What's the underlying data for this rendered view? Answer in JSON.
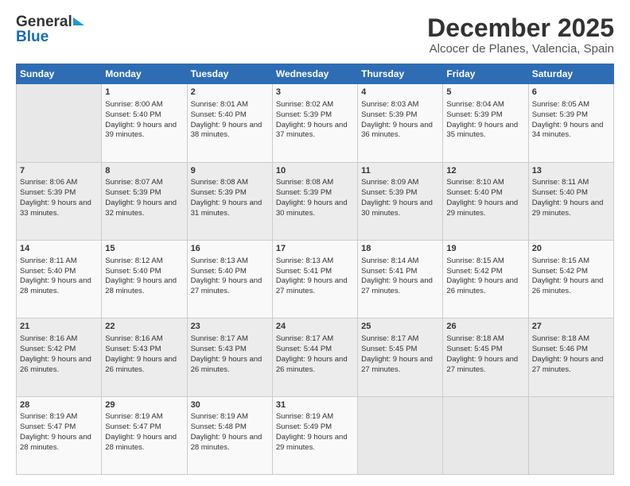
{
  "header": {
    "logo_general": "General",
    "logo_blue": "Blue",
    "title": "December 2025",
    "subtitle": "Alcocer de Planes, Valencia, Spain"
  },
  "weekdays": [
    "Sunday",
    "Monday",
    "Tuesday",
    "Wednesday",
    "Thursday",
    "Friday",
    "Saturday"
  ],
  "weeks": [
    [
      {
        "day": "",
        "sunrise": "",
        "sunset": "",
        "daylight": ""
      },
      {
        "day": "1",
        "sunrise": "Sunrise: 8:00 AM",
        "sunset": "Sunset: 5:40 PM",
        "daylight": "Daylight: 9 hours and 39 minutes."
      },
      {
        "day": "2",
        "sunrise": "Sunrise: 8:01 AM",
        "sunset": "Sunset: 5:40 PM",
        "daylight": "Daylight: 9 hours and 38 minutes."
      },
      {
        "day": "3",
        "sunrise": "Sunrise: 8:02 AM",
        "sunset": "Sunset: 5:39 PM",
        "daylight": "Daylight: 9 hours and 37 minutes."
      },
      {
        "day": "4",
        "sunrise": "Sunrise: 8:03 AM",
        "sunset": "Sunset: 5:39 PM",
        "daylight": "Daylight: 9 hours and 36 minutes."
      },
      {
        "day": "5",
        "sunrise": "Sunrise: 8:04 AM",
        "sunset": "Sunset: 5:39 PM",
        "daylight": "Daylight: 9 hours and 35 minutes."
      },
      {
        "day": "6",
        "sunrise": "Sunrise: 8:05 AM",
        "sunset": "Sunset: 5:39 PM",
        "daylight": "Daylight: 9 hours and 34 minutes."
      }
    ],
    [
      {
        "day": "7",
        "sunrise": "Sunrise: 8:06 AM",
        "sunset": "Sunset: 5:39 PM",
        "daylight": "Daylight: 9 hours and 33 minutes."
      },
      {
        "day": "8",
        "sunrise": "Sunrise: 8:07 AM",
        "sunset": "Sunset: 5:39 PM",
        "daylight": "Daylight: 9 hours and 32 minutes."
      },
      {
        "day": "9",
        "sunrise": "Sunrise: 8:08 AM",
        "sunset": "Sunset: 5:39 PM",
        "daylight": "Daylight: 9 hours and 31 minutes."
      },
      {
        "day": "10",
        "sunrise": "Sunrise: 8:08 AM",
        "sunset": "Sunset: 5:39 PM",
        "daylight": "Daylight: 9 hours and 30 minutes."
      },
      {
        "day": "11",
        "sunrise": "Sunrise: 8:09 AM",
        "sunset": "Sunset: 5:39 PM",
        "daylight": "Daylight: 9 hours and 30 minutes."
      },
      {
        "day": "12",
        "sunrise": "Sunrise: 8:10 AM",
        "sunset": "Sunset: 5:40 PM",
        "daylight": "Daylight: 9 hours and 29 minutes."
      },
      {
        "day": "13",
        "sunrise": "Sunrise: 8:11 AM",
        "sunset": "Sunset: 5:40 PM",
        "daylight": "Daylight: 9 hours and 29 minutes."
      }
    ],
    [
      {
        "day": "14",
        "sunrise": "Sunrise: 8:11 AM",
        "sunset": "Sunset: 5:40 PM",
        "daylight": "Daylight: 9 hours and 28 minutes."
      },
      {
        "day": "15",
        "sunrise": "Sunrise: 8:12 AM",
        "sunset": "Sunset: 5:40 PM",
        "daylight": "Daylight: 9 hours and 28 minutes."
      },
      {
        "day": "16",
        "sunrise": "Sunrise: 8:13 AM",
        "sunset": "Sunset: 5:40 PM",
        "daylight": "Daylight: 9 hours and 27 minutes."
      },
      {
        "day": "17",
        "sunrise": "Sunrise: 8:13 AM",
        "sunset": "Sunset: 5:41 PM",
        "daylight": "Daylight: 9 hours and 27 minutes."
      },
      {
        "day": "18",
        "sunrise": "Sunrise: 8:14 AM",
        "sunset": "Sunset: 5:41 PM",
        "daylight": "Daylight: 9 hours and 27 minutes."
      },
      {
        "day": "19",
        "sunrise": "Sunrise: 8:15 AM",
        "sunset": "Sunset: 5:42 PM",
        "daylight": "Daylight: 9 hours and 26 minutes."
      },
      {
        "day": "20",
        "sunrise": "Sunrise: 8:15 AM",
        "sunset": "Sunset: 5:42 PM",
        "daylight": "Daylight: 9 hours and 26 minutes."
      }
    ],
    [
      {
        "day": "21",
        "sunrise": "Sunrise: 8:16 AM",
        "sunset": "Sunset: 5:42 PM",
        "daylight": "Daylight: 9 hours and 26 minutes."
      },
      {
        "day": "22",
        "sunrise": "Sunrise: 8:16 AM",
        "sunset": "Sunset: 5:43 PM",
        "daylight": "Daylight: 9 hours and 26 minutes."
      },
      {
        "day": "23",
        "sunrise": "Sunrise: 8:17 AM",
        "sunset": "Sunset: 5:43 PM",
        "daylight": "Daylight: 9 hours and 26 minutes."
      },
      {
        "day": "24",
        "sunrise": "Sunrise: 8:17 AM",
        "sunset": "Sunset: 5:44 PM",
        "daylight": "Daylight: 9 hours and 26 minutes."
      },
      {
        "day": "25",
        "sunrise": "Sunrise: 8:17 AM",
        "sunset": "Sunset: 5:45 PM",
        "daylight": "Daylight: 9 hours and 27 minutes."
      },
      {
        "day": "26",
        "sunrise": "Sunrise: 8:18 AM",
        "sunset": "Sunset: 5:45 PM",
        "daylight": "Daylight: 9 hours and 27 minutes."
      },
      {
        "day": "27",
        "sunrise": "Sunrise: 8:18 AM",
        "sunset": "Sunset: 5:46 PM",
        "daylight": "Daylight: 9 hours and 27 minutes."
      }
    ],
    [
      {
        "day": "28",
        "sunrise": "Sunrise: 8:19 AM",
        "sunset": "Sunset: 5:47 PM",
        "daylight": "Daylight: 9 hours and 28 minutes."
      },
      {
        "day": "29",
        "sunrise": "Sunrise: 8:19 AM",
        "sunset": "Sunset: 5:47 PM",
        "daylight": "Daylight: 9 hours and 28 minutes."
      },
      {
        "day": "30",
        "sunrise": "Sunrise: 8:19 AM",
        "sunset": "Sunset: 5:48 PM",
        "daylight": "Daylight: 9 hours and 28 minutes."
      },
      {
        "day": "31",
        "sunrise": "Sunrise: 8:19 AM",
        "sunset": "Sunset: 5:49 PM",
        "daylight": "Daylight: 9 hours and 29 minutes."
      },
      {
        "day": "",
        "sunrise": "",
        "sunset": "",
        "daylight": ""
      },
      {
        "day": "",
        "sunrise": "",
        "sunset": "",
        "daylight": ""
      },
      {
        "day": "",
        "sunrise": "",
        "sunset": "",
        "daylight": ""
      }
    ]
  ]
}
